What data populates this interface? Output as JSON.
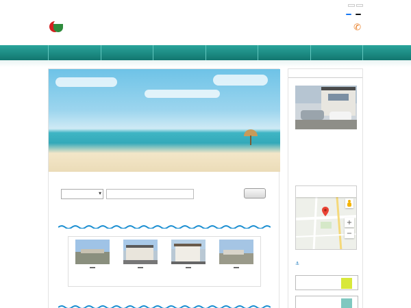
{
  "header": {
    "tagline": "",
    "links": [],
    "sns": [],
    "logo_text": "",
    "phone": "",
    "hours": ""
  },
  "nav": [],
  "hero": {
    "line1": "",
    "line2": "",
    "line2_city": "",
    "line3": "",
    "line4": ""
  },
  "search": {
    "select_value": "",
    "keyword_placeholder": "",
    "count": "",
    "count_unit": "",
    "button": ""
  },
  "new_section_title": "",
  "recommended_section_title": "",
  "properties": [],
  "sidebar": {
    "title": "",
    "company": "",
    "postal": "",
    "address": "",
    "tel": "",
    "fax": "",
    "map_tab_map": "",
    "map_tab_satellite": "",
    "map_label": "",
    "map_google": "",
    "map_data": "",
    "category_title": "",
    "category_suffix": "",
    "buttons": []
  },
  "colors": {
    "nav_teal": "#1a8c84",
    "phone_orange": "#e87a1f",
    "price_red": "#d02020",
    "section_blue": "#1c7bbf"
  }
}
